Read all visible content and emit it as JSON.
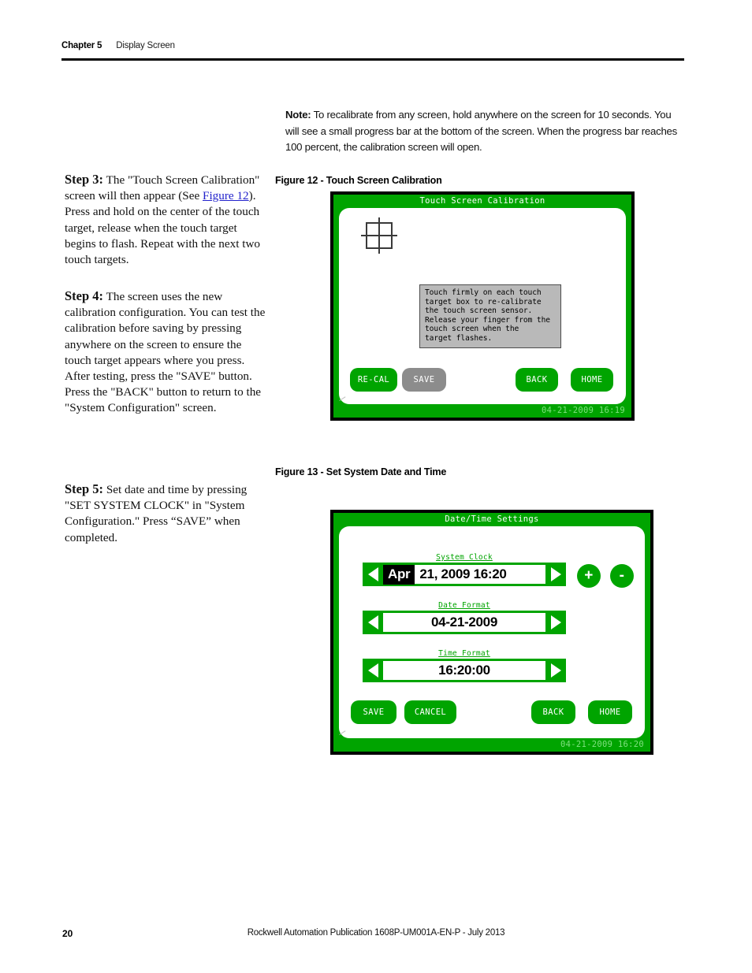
{
  "header": {
    "chapter": "Chapter 5",
    "section": "Display Screen"
  },
  "note": {
    "label": "Note:",
    "text": " To recalibrate from any screen, hold anywhere on the screen for 10 seconds. You will see a small progress bar at the bottom of the screen. When the progress bar reaches 100 percent, the calibration screen will open."
  },
  "steps": {
    "step3": {
      "label": "Step 3:",
      "text_before_link": "  The \"Touch Screen Calibration\" screen will then appear (See ",
      "link": "Figure 12",
      "text_after_link": "). Press and hold on the center of the touch target, release when the touch target begins to flash. Repeat with the next two touch targets."
    },
    "step4": {
      "label": "Step 4:",
      "text": " The screen uses the new calibration configuration. You can test the calibration before saving by pressing anywhere on the screen to ensure the touch target appears where you press. After testing, press the \"SAVE\" button. Press the \"BACK\" button to return to the \"System Configuration\" screen."
    },
    "step5": {
      "label": "Step 5:",
      "text": "  Set date and time by pressing \"SET SYSTEM CLOCK\" in \"System Configuration.\" Press “SAVE” when completed."
    }
  },
  "figures": {
    "fig12": {
      "caption": "Figure 12 - Touch Screen Calibration",
      "screen_title": "Touch Screen Calibration",
      "instruction_text": "Touch firmly on each touch\ntarget box to re-calibrate\nthe touch screen sensor.\nRelease your finger from the\ntouch screen when the\ntarget flashes.",
      "buttons": {
        "recal": "RE-CAL",
        "save": "SAVE",
        "back": "BACK",
        "home": "HOME"
      },
      "timestamp": "04-21-2009 16:19"
    },
    "fig13": {
      "caption": "Figure 13 - Set System Date and Time",
      "screen_title": "Date/Time Settings",
      "rows": [
        {
          "label": "System Clock",
          "highlighted_segment": "Apr",
          "value": "21, 2009 16:20"
        },
        {
          "label": "Date Format",
          "value": "04-21-2009"
        },
        {
          "label": "Time Format",
          "value": "16:20:00"
        }
      ],
      "plus_label": "+",
      "minus_label": "-",
      "buttons": {
        "save": "SAVE",
        "cancel": "CANCEL",
        "back": "BACK",
        "home": "HOME"
      },
      "timestamp": "04-21-2009 16:20"
    }
  },
  "footer": {
    "page_number": "20",
    "publication": "Rockwell Automation Publication 1608P-UM001A-EN-P - July 2013"
  },
  "colors": {
    "hmi_green": "#00a400",
    "hmi_disabled_gray": "#8c8c8c",
    "instruction_box_gray": "#b9b9b9",
    "link_blue": "#2222cc",
    "footer_text_green": "#7fe07f"
  }
}
